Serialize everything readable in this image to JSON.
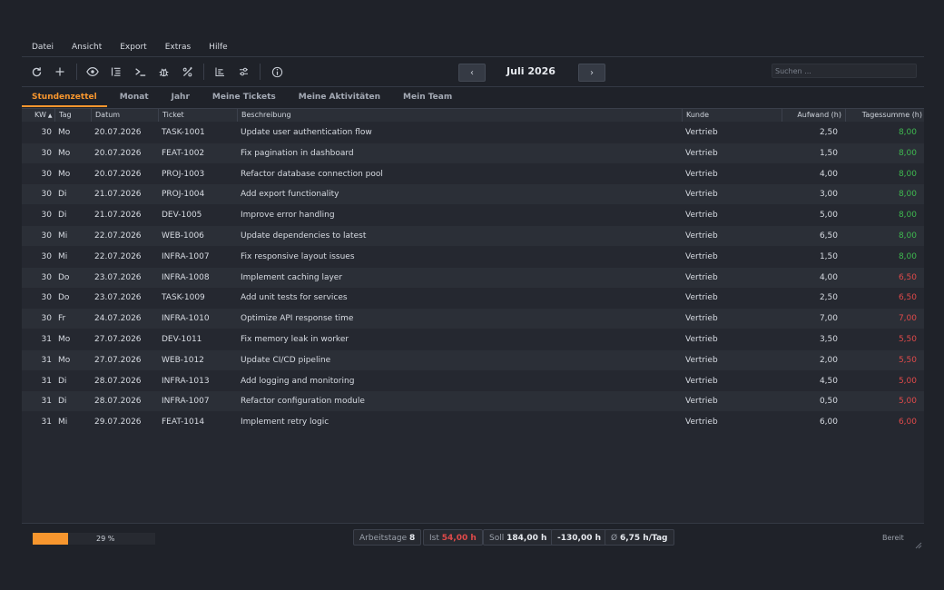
{
  "menu": [
    "Datei",
    "Ansicht",
    "Export",
    "Extras",
    "Hilfe"
  ],
  "toolbar": {
    "month": "Juli 2026",
    "prev": "‹",
    "next": "›",
    "search_placeholder": "Suchen ..."
  },
  "tabs": [
    "Stundenzettel",
    "Monat",
    "Jahr",
    "Meine Tickets",
    "Meine Aktivitäten",
    "Mein Team"
  ],
  "columns": {
    "kw": "KW",
    "tag": "Tag",
    "datum": "Datum",
    "ticket": "Ticket",
    "beschreibung": "Beschreibung",
    "kunde": "Kunde",
    "aufwand": "Aufwand (h)",
    "tagessumme": "Tagessumme (h)"
  },
  "rows": [
    {
      "kw": "30",
      "tag": "Mo",
      "datum": "20.07.2026",
      "ticket": "TASK-1001",
      "beschreibung": "Update user authentication flow",
      "kunde": "Vertrieb",
      "aufwand": "2,50",
      "tagessumme": "8,00",
      "sum_status": "ok"
    },
    {
      "kw": "30",
      "tag": "Mo",
      "datum": "20.07.2026",
      "ticket": "FEAT-1002",
      "beschreibung": "Fix pagination in dashboard",
      "kunde": "Vertrieb",
      "aufwand": "1,50",
      "tagessumme": "8,00",
      "sum_status": "ok"
    },
    {
      "kw": "30",
      "tag": "Mo",
      "datum": "20.07.2026",
      "ticket": "PROJ-1003",
      "beschreibung": "Refactor database connection pool",
      "kunde": "Vertrieb",
      "aufwand": "4,00",
      "tagessumme": "8,00",
      "sum_status": "ok"
    },
    {
      "kw": "30",
      "tag": "Di",
      "datum": "21.07.2026",
      "ticket": "PROJ-1004",
      "beschreibung": "Add export functionality",
      "kunde": "Vertrieb",
      "aufwand": "3,00",
      "tagessumme": "8,00",
      "sum_status": "ok"
    },
    {
      "kw": "30",
      "tag": "Di",
      "datum": "21.07.2026",
      "ticket": "DEV-1005",
      "beschreibung": "Improve error handling",
      "kunde": "Vertrieb",
      "aufwand": "5,00",
      "tagessumme": "8,00",
      "sum_status": "ok"
    },
    {
      "kw": "30",
      "tag": "Mi",
      "datum": "22.07.2026",
      "ticket": "WEB-1006",
      "beschreibung": "Update dependencies to latest",
      "kunde": "Vertrieb",
      "aufwand": "6,50",
      "tagessumme": "8,00",
      "sum_status": "ok"
    },
    {
      "kw": "30",
      "tag": "Mi",
      "datum": "22.07.2026",
      "ticket": "INFRA-1007",
      "beschreibung": "Fix responsive layout issues",
      "kunde": "Vertrieb",
      "aufwand": "1,50",
      "tagessumme": "8,00",
      "sum_status": "ok"
    },
    {
      "kw": "30",
      "tag": "Do",
      "datum": "23.07.2026",
      "ticket": "INFRA-1008",
      "beschreibung": "Implement caching layer",
      "kunde": "Vertrieb",
      "aufwand": "4,00",
      "tagessumme": "6,50",
      "sum_status": "low"
    },
    {
      "kw": "30",
      "tag": "Do",
      "datum": "23.07.2026",
      "ticket": "TASK-1009",
      "beschreibung": "Add unit tests for services",
      "kunde": "Vertrieb",
      "aufwand": "2,50",
      "tagessumme": "6,50",
      "sum_status": "low"
    },
    {
      "kw": "30",
      "tag": "Fr",
      "datum": "24.07.2026",
      "ticket": "INFRA-1010",
      "beschreibung": "Optimize API response time",
      "kunde": "Vertrieb",
      "aufwand": "7,00",
      "tagessumme": "7,00",
      "sum_status": "low"
    },
    {
      "kw": "31",
      "tag": "Mo",
      "datum": "27.07.2026",
      "ticket": "DEV-1011",
      "beschreibung": "Fix memory leak in worker",
      "kunde": "Vertrieb",
      "aufwand": "3,50",
      "tagessumme": "5,50",
      "sum_status": "low"
    },
    {
      "kw": "31",
      "tag": "Mo",
      "datum": "27.07.2026",
      "ticket": "WEB-1012",
      "beschreibung": "Update CI/CD pipeline",
      "kunde": "Vertrieb",
      "aufwand": "2,00",
      "tagessumme": "5,50",
      "sum_status": "low"
    },
    {
      "kw": "31",
      "tag": "Di",
      "datum": "28.07.2026",
      "ticket": "INFRA-1013",
      "beschreibung": "Add logging and monitoring",
      "kunde": "Vertrieb",
      "aufwand": "4,50",
      "tagessumme": "5,00",
      "sum_status": "low"
    },
    {
      "kw": "31",
      "tag": "Di",
      "datum": "28.07.2026",
      "ticket": "INFRA-1007",
      "beschreibung": "Refactor configuration module",
      "kunde": "Vertrieb",
      "aufwand": "0,50",
      "tagessumme": "5,00",
      "sum_status": "low"
    },
    {
      "kw": "31",
      "tag": "Mi",
      "datum": "29.07.2026",
      "ticket": "FEAT-1014",
      "beschreibung": "Implement retry logic",
      "kunde": "Vertrieb",
      "aufwand": "6,00",
      "tagessumme": "6,00",
      "sum_status": "low"
    }
  ],
  "status": {
    "progress_percent": 29,
    "progress_label": "29 %",
    "arbeitstage_label": "Arbeitstage",
    "arbeitstage_value": "8",
    "ist_label": "Ist",
    "ist_value": "54,00 h",
    "soll_label": "Soll",
    "soll_value": "184,00 h",
    "diff_value": "-130,00 h",
    "avg_symbol": "Ø",
    "avg_value": "6,75 h/Tag",
    "ready": "Bereit"
  },
  "colors": {
    "accent": "#f7962e",
    "ok": "#3fb950",
    "low": "#e04a4a"
  }
}
